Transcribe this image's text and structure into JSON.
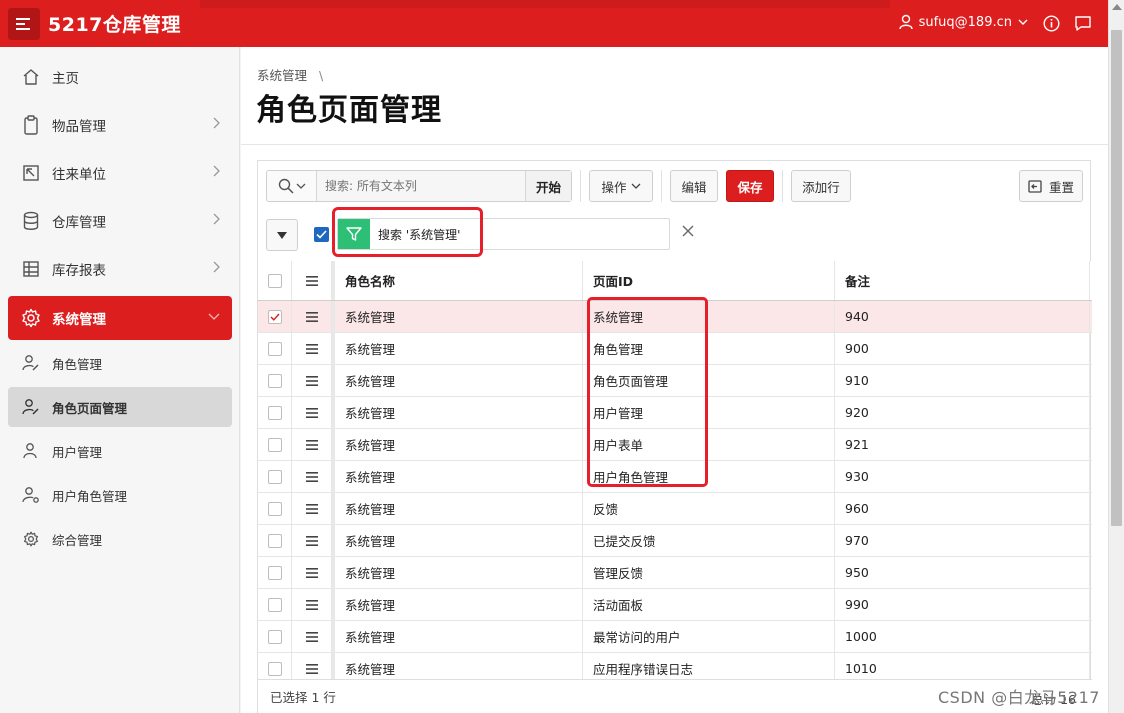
{
  "header": {
    "app_title": "5217仓库管理",
    "user": "sufuq@189.cn",
    "colors": {
      "brand": "#dc1e1e",
      "accent": "#1f68c0",
      "filter": "#2dbf76"
    }
  },
  "sidebar": {
    "items": [
      {
        "label": "主页",
        "icon": "home-icon"
      },
      {
        "label": "物品管理",
        "icon": "clipboard-icon"
      },
      {
        "label": "往来单位",
        "icon": "arrow-box-icon"
      },
      {
        "label": "仓库管理",
        "icon": "database-icon"
      },
      {
        "label": "库存报表",
        "icon": "table-icon"
      },
      {
        "label": "系统管理",
        "icon": "gear-icon"
      }
    ],
    "subitems": [
      {
        "label": "角色管理",
        "icon": "user-edit-icon"
      },
      {
        "label": "角色页面管理",
        "icon": "user-edit-icon"
      },
      {
        "label": "用户管理",
        "icon": "users-icon"
      },
      {
        "label": "用户角色管理",
        "icon": "user-gear-icon"
      },
      {
        "label": "综合管理",
        "icon": "gear-icon"
      }
    ]
  },
  "main": {
    "breadcrumb": "系统管理",
    "title": "角色页面管理",
    "toolbar": {
      "search_placeholder": "搜索: 所有文本列",
      "go": "开始",
      "actions": "操作",
      "edit": "编辑",
      "save": "保存",
      "add_row": "添加行",
      "reset": "重置"
    },
    "filter_label": "搜索 '系统管理'",
    "columns": [
      "角色名称",
      "页面ID",
      "备注"
    ],
    "rows": [
      {
        "role": "系统管理",
        "page": "系统管理",
        "note": "940"
      },
      {
        "role": "系统管理",
        "page": "角色管理",
        "note": "900"
      },
      {
        "role": "系统管理",
        "page": "角色页面管理",
        "note": "910"
      },
      {
        "role": "系统管理",
        "page": "用户管理",
        "note": "920"
      },
      {
        "role": "系统管理",
        "page": "用户表单",
        "note": "921"
      },
      {
        "role": "系统管理",
        "page": "用户角色管理",
        "note": "930"
      },
      {
        "role": "系统管理",
        "page": "反馈",
        "note": "960"
      },
      {
        "role": "系统管理",
        "page": "已提交反馈",
        "note": "970"
      },
      {
        "role": "系统管理",
        "page": "管理反馈",
        "note": "950"
      },
      {
        "role": "系统管理",
        "page": "活动面板",
        "note": "990"
      },
      {
        "role": "系统管理",
        "page": "最常访问的用户",
        "note": "1000"
      },
      {
        "role": "系统管理",
        "page": "应用程序错误日志",
        "note": "1010"
      }
    ],
    "footer_selected": "已选择 1 行",
    "footer_total": "总计 16"
  },
  "watermark": "CSDN @白龙马5217"
}
